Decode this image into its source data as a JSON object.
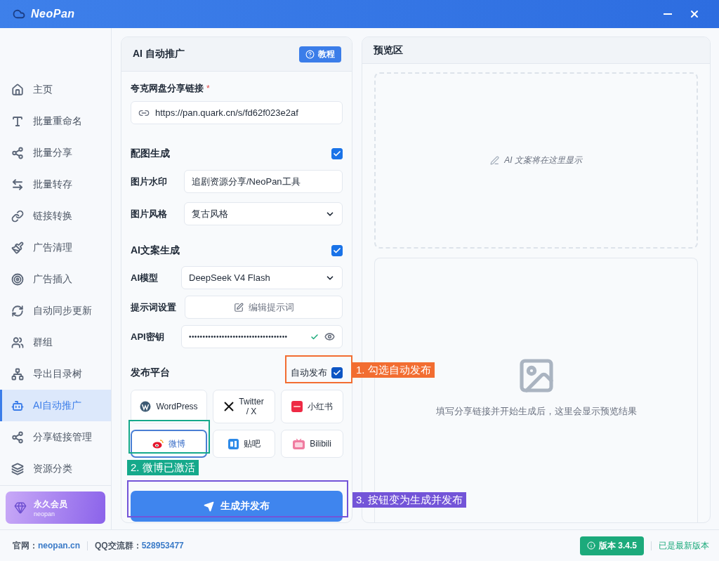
{
  "window": {
    "title": "NeoPan"
  },
  "sidebar": {
    "items": [
      {
        "label": "主页",
        "selected": false
      },
      {
        "label": "批量重命名",
        "selected": false
      },
      {
        "label": "批量分享",
        "selected": false
      },
      {
        "label": "批量转存",
        "selected": false
      },
      {
        "label": "链接转换",
        "selected": false
      },
      {
        "label": "广告清理",
        "selected": false
      },
      {
        "label": "广告插入",
        "selected": false
      },
      {
        "label": "自动同步更新",
        "selected": false
      },
      {
        "label": "群组",
        "selected": false
      },
      {
        "label": "导出目录树",
        "selected": false
      },
      {
        "label": "AI自动推广",
        "selected": true
      },
      {
        "label": "分享链接管理",
        "selected": false
      },
      {
        "label": "资源分类",
        "selected": false
      }
    ],
    "membership": {
      "title": "永久会员",
      "subtitle": "neopan"
    }
  },
  "form": {
    "title": "AI 自动推广",
    "help_button": "教程",
    "link": {
      "label": "夸克网盘分享链接",
      "required_mark": "*",
      "value": "https://pan.quark.cn/s/fd62f023e2af"
    },
    "image_section": {
      "title": "配图生成",
      "checked": true,
      "watermark": {
        "label": "图片水印",
        "value": "追剧资源分享/NeoPan工具"
      },
      "style": {
        "label": "图片风格",
        "value": "复古风格"
      }
    },
    "copy_section": {
      "title": "AI文案生成",
      "checked": true,
      "model": {
        "label": "AI模型",
        "value": "DeepSeek V4 Flash"
      },
      "prompt": {
        "label": "提示词设置",
        "button": "编辑提示词"
      },
      "api_key": {
        "label": "API密钥",
        "value": "••••••••••••••••••••••••••••••••••••",
        "verified": true
      }
    },
    "publish": {
      "title": "发布平台",
      "auto_publish": {
        "label": "自动发布",
        "checked": true
      },
      "platforms": [
        {
          "label": "WordPress",
          "selected": false
        },
        {
          "label": "Twitter / X",
          "selected": false
        },
        {
          "label": "小红书",
          "selected": false
        },
        {
          "label": "微博",
          "selected": true
        },
        {
          "label": "贴吧",
          "selected": false
        },
        {
          "label": "Bilibili",
          "selected": false
        }
      ]
    },
    "submit": "生成并发布"
  },
  "preview": {
    "title": "预览区",
    "text_placeholder": "AI 文案将在这里显示",
    "image_placeholder": "填写分享链接并开始生成后，这里会显示预览结果"
  },
  "footer": {
    "site_label": "官网：",
    "site": "neopan.cn",
    "qq_label": "QQ交流群：",
    "qq": "528953477",
    "version": "版本 3.4.5",
    "status": "已是最新版本"
  },
  "annotations": [
    {
      "text": "1. 勾选自动发布",
      "color": "#f26d31"
    },
    {
      "text": "2. 微博已激活",
      "color": "#15a98b"
    },
    {
      "text": "3. 按钮变为生成并发布",
      "color": "#7354d8"
    }
  ]
}
